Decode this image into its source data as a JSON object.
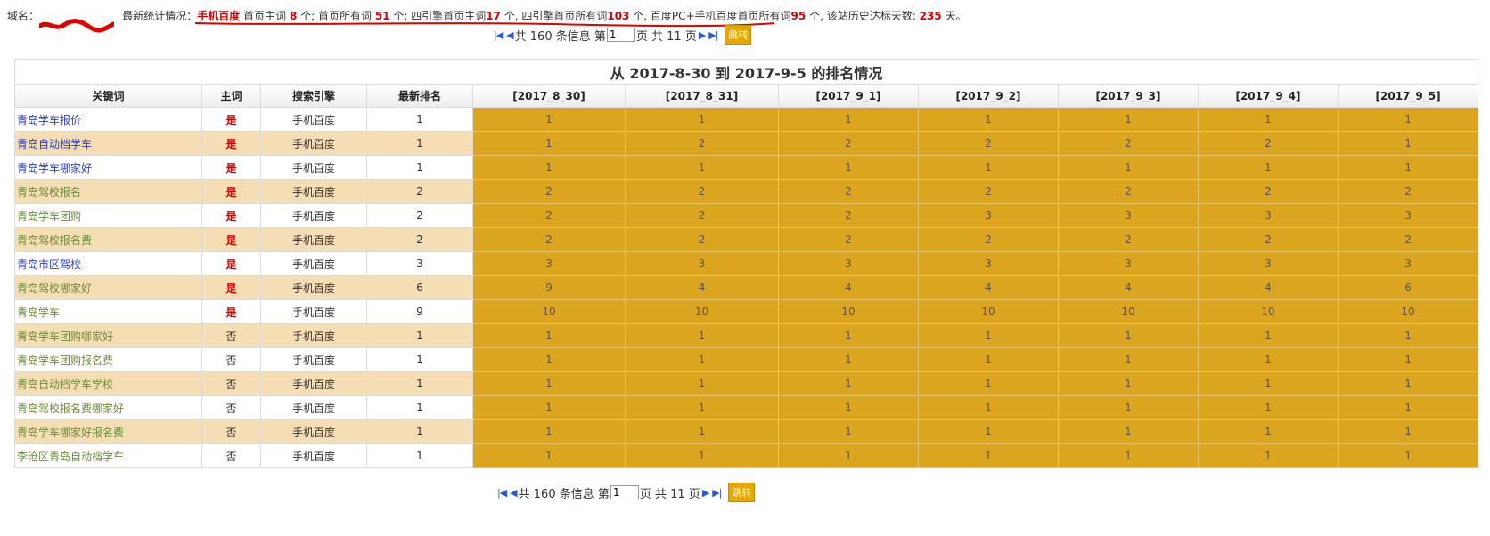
{
  "summary": {
    "domain_label": "域名：",
    "domain_value": "",
    "stats_label": "最新统计情况：",
    "seg1": "手机百度",
    "seg2": " 首页主词 ",
    "num1": "8",
    "seg3": " 个; 首页所有词 ",
    "num2": "51",
    "seg4": " 个; 四引擎首页主词",
    "num3": "17",
    "seg5": " 个, 四引擎首页所有词",
    "num4": "103",
    "seg6": " 个, 百度PC+手机百度首页所有词",
    "num5": "95",
    "seg7": " 个, 该站历史达标天数: ",
    "num6": "235",
    "seg8": " 天。"
  },
  "pager": {
    "first_icon": "first-page-icon",
    "prev_icon": "prev-page-icon",
    "next_icon": "next-page-icon",
    "last_icon": "last-page-icon",
    "total_text": "共 160 条信息 第",
    "page_value": "1",
    "pages_text": "页 共 11 页",
    "go_label": "跳转"
  },
  "table": {
    "title": "从 2017-8-30 到 2017-9-5 的排名情况",
    "headers": [
      "关键词",
      "主词",
      "搜索引擎",
      "最新排名",
      "[2017_8_30]",
      "[2017_8_31]",
      "[2017_9_1]",
      "[2017_9_2]",
      "[2017_9_3]",
      "[2017_9_4]",
      "[2017_9_5]"
    ],
    "rows": [
      {
        "kw": "青岛学车报价",
        "kw_color": "blue",
        "main": "是",
        "engine": "手机百度",
        "latest": "1",
        "days": [
          "1",
          "1",
          "1",
          "1",
          "1",
          "1",
          "1"
        ]
      },
      {
        "kw": "青岛自动档学车",
        "kw_color": "blue",
        "main": "是",
        "engine": "手机百度",
        "latest": "1",
        "days": [
          "1",
          "2",
          "2",
          "2",
          "2",
          "2",
          "1"
        ]
      },
      {
        "kw": "青岛学车哪家好",
        "kw_color": "blue",
        "main": "是",
        "engine": "手机百度",
        "latest": "1",
        "days": [
          "1",
          "1",
          "1",
          "1",
          "1",
          "1",
          "1"
        ]
      },
      {
        "kw": "青岛驾校报名",
        "kw_color": "green",
        "main": "是",
        "engine": "手机百度",
        "latest": "2",
        "days": [
          "2",
          "2",
          "2",
          "2",
          "2",
          "2",
          "2"
        ]
      },
      {
        "kw": "青岛学车团购",
        "kw_color": "green",
        "main": "是",
        "engine": "手机百度",
        "latest": "2",
        "days": [
          "2",
          "2",
          "2",
          "3",
          "3",
          "3",
          "3"
        ]
      },
      {
        "kw": "青岛驾校报名费",
        "kw_color": "green",
        "main": "是",
        "engine": "手机百度",
        "latest": "2",
        "days": [
          "2",
          "2",
          "2",
          "2",
          "2",
          "2",
          "2"
        ]
      },
      {
        "kw": "青岛市区驾校",
        "kw_color": "blue",
        "main": "是",
        "engine": "手机百度",
        "latest": "3",
        "days": [
          "3",
          "3",
          "3",
          "3",
          "3",
          "3",
          "3"
        ]
      },
      {
        "kw": "青岛驾校哪家好",
        "kw_color": "green",
        "main": "是",
        "engine": "手机百度",
        "latest": "6",
        "days": [
          "9",
          "4",
          "4",
          "4",
          "4",
          "4",
          "6"
        ]
      },
      {
        "kw": "青岛学车",
        "kw_color": "green",
        "main": "是",
        "engine": "手机百度",
        "latest": "9",
        "days": [
          "10",
          "10",
          "10",
          "10",
          "10",
          "10",
          "10"
        ]
      },
      {
        "kw": "青岛学车团购哪家好",
        "kw_color": "green",
        "main": "否",
        "engine": "手机百度",
        "latest": "1",
        "days": [
          "1",
          "1",
          "1",
          "1",
          "1",
          "1",
          "1"
        ]
      },
      {
        "kw": "青岛学车团购报名费",
        "kw_color": "green",
        "main": "否",
        "engine": "手机百度",
        "latest": "1",
        "days": [
          "1",
          "1",
          "1",
          "1",
          "1",
          "1",
          "1"
        ]
      },
      {
        "kw": "青岛自动档学车学校",
        "kw_color": "green",
        "main": "否",
        "engine": "手机百度",
        "latest": "1",
        "days": [
          "1",
          "1",
          "1",
          "1",
          "1",
          "1",
          "1"
        ]
      },
      {
        "kw": "青岛驾校报名费哪家好",
        "kw_color": "green",
        "main": "否",
        "engine": "手机百度",
        "latest": "1",
        "days": [
          "1",
          "1",
          "1",
          "1",
          "1",
          "1",
          "1"
        ]
      },
      {
        "kw": "青岛学车哪家好报名费",
        "kw_color": "green",
        "main": "否",
        "engine": "手机百度",
        "latest": "1",
        "days": [
          "1",
          "1",
          "1",
          "1",
          "1",
          "1",
          "1"
        ]
      },
      {
        "kw": "李沧区青岛自动档学车",
        "kw_color": "green",
        "main": "否",
        "engine": "手机百度",
        "latest": "1",
        "days": [
          "1",
          "1",
          "1",
          "1",
          "1",
          "1",
          "1"
        ]
      }
    ]
  },
  "colors": {
    "day_cell": "#dba51f",
    "even_row": "#f5deb3",
    "highlight_red": "#d40000",
    "keyword_blue": "#2a3ecf",
    "keyword_green": "#6b8e3a"
  }
}
